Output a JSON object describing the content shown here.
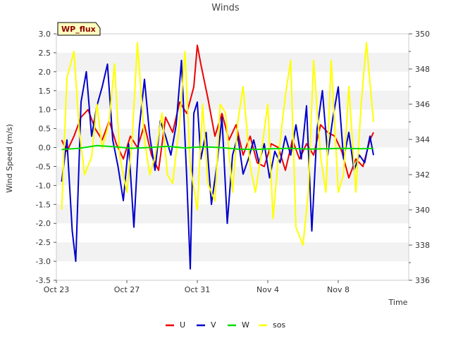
{
  "chart_data": {
    "type": "line",
    "title": "Winds",
    "site_label": "WP_flux",
    "xlabel": "Time",
    "ylabel": "Wind Speed (m/s)",
    "ylim": [
      -3.5,
      3.0
    ],
    "y2lim": [
      336,
      350
    ],
    "xlim_days": [
      23,
      43
    ],
    "x_ticks": [
      {
        "day": 23,
        "label": "Oct 23"
      },
      {
        "day": 27,
        "label": "Oct 27"
      },
      {
        "day": 31,
        "label": "Oct 31"
      },
      {
        "day": 35,
        "label": "Nov 4"
      },
      {
        "day": 39,
        "label": "Nov 8"
      }
    ],
    "y_ticks": [
      3.0,
      2.5,
      2.0,
      1.5,
      1.0,
      0.5,
      0.0,
      -0.5,
      -1.0,
      -1.5,
      -2.0,
      -2.5,
      -3.0,
      -3.5
    ],
    "y2_ticks": [
      350,
      348,
      346,
      344,
      342,
      340,
      338,
      336
    ],
    "grid": "horizontal bands",
    "legend_position": "bottom",
    "series": [
      {
        "name": "U",
        "color": "#ee0000",
        "axis": "left",
        "x": [
          23.3,
          23.6,
          24.0,
          24.4,
          24.8,
          25.2,
          25.6,
          26.0,
          26.4,
          26.8,
          27.2,
          27.6,
          28.0,
          28.4,
          28.8,
          29.2,
          29.6,
          30.0,
          30.4,
          30.8,
          31.0,
          31.2,
          31.6,
          32.0,
          32.4,
          32.8,
          33.2,
          33.6,
          34.0,
          34.4,
          34.8,
          35.2,
          35.6,
          36.0,
          36.4,
          36.8,
          37.2,
          37.6,
          38.0,
          38.4,
          38.8,
          39.2,
          39.6,
          40.0,
          40.4,
          40.8,
          41.0
        ],
        "values": [
          0.2,
          -0.1,
          0.3,
          0.8,
          1.0,
          0.5,
          0.2,
          0.7,
          0.1,
          -0.3,
          0.3,
          0.0,
          0.6,
          -0.2,
          -0.6,
          0.8,
          0.4,
          1.2,
          0.9,
          1.6,
          2.7,
          2.2,
          1.3,
          0.3,
          0.9,
          0.2,
          0.6,
          -0.2,
          0.3,
          -0.4,
          -0.5,
          0.1,
          0.0,
          -0.6,
          0.2,
          -0.3,
          0.1,
          -0.2,
          0.6,
          0.4,
          0.3,
          -0.1,
          -0.8,
          -0.3,
          -0.5,
          0.2,
          0.4
        ]
      },
      {
        "name": "V",
        "color": "#0000cc",
        "axis": "left",
        "x": [
          23.3,
          23.6,
          23.9,
          24.1,
          24.4,
          24.7,
          25.0,
          25.3,
          25.6,
          25.9,
          26.2,
          26.5,
          26.8,
          27.1,
          27.4,
          27.7,
          28.0,
          28.3,
          28.6,
          28.9,
          29.2,
          29.5,
          29.8,
          30.1,
          30.4,
          30.6,
          30.8,
          31.0,
          31.2,
          31.5,
          31.8,
          32.1,
          32.4,
          32.7,
          33.0,
          33.3,
          33.6,
          33.9,
          34.2,
          34.5,
          34.8,
          35.1,
          35.4,
          35.7,
          36.0,
          36.3,
          36.6,
          36.9,
          37.2,
          37.5,
          37.8,
          38.1,
          38.4,
          38.7,
          39.0,
          39.3,
          39.6,
          39.9,
          40.2,
          40.5,
          40.8,
          41.0
        ],
        "values": [
          -0.9,
          0.2,
          -2.2,
          -3.0,
          1.2,
          2.0,
          0.3,
          1.1,
          1.6,
          2.2,
          0.2,
          -0.5,
          -1.4,
          0.1,
          -2.1,
          0.5,
          1.8,
          0.3,
          -0.6,
          0.7,
          0.3,
          -0.2,
          0.6,
          2.3,
          -0.8,
          -3.2,
          0.9,
          1.2,
          -0.3,
          0.4,
          -1.5,
          -0.5,
          0.8,
          -2.0,
          -0.2,
          0.3,
          -0.7,
          -0.3,
          0.2,
          -0.4,
          0.1,
          -0.8,
          -0.1,
          -0.4,
          0.3,
          -0.2,
          0.6,
          -0.3,
          1.1,
          -2.2,
          0.5,
          1.5,
          -0.2,
          0.8,
          1.6,
          -0.3,
          0.4,
          -0.6,
          -0.2,
          -0.4,
          0.3,
          -0.2
        ]
      },
      {
        "name": "W",
        "color": "#00dd00",
        "axis": "left",
        "x": [
          23.3,
          24.3,
          25.3,
          26.3,
          27.3,
          28.3,
          29.3,
          30.3,
          31.3,
          32.3,
          33.3,
          34.3,
          35.3,
          36.3,
          37.3,
          38.3,
          39.3,
          40.3,
          41.0
        ],
        "values": [
          -0.05,
          -0.02,
          0.05,
          0.02,
          -0.02,
          0.0,
          0.03,
          -0.01,
          0.02,
          0.0,
          -0.04,
          -0.05,
          -0.03,
          -0.02,
          -0.04,
          -0.03,
          -0.02,
          -0.03,
          -0.02
        ]
      },
      {
        "name": "sos",
        "color": "#ffff00",
        "axis": "right",
        "x": [
          23.3,
          23.6,
          24.0,
          24.3,
          24.6,
          25.0,
          25.3,
          25.6,
          26.0,
          26.3,
          26.6,
          27.0,
          27.3,
          27.6,
          28.0,
          28.3,
          28.6,
          29.0,
          29.3,
          29.6,
          30.0,
          30.3,
          30.6,
          31.0,
          31.3,
          31.6,
          32.0,
          32.3,
          32.6,
          33.0,
          33.3,
          33.6,
          34.0,
          34.3,
          34.6,
          35.0,
          35.3,
          35.6,
          36.0,
          36.3,
          36.6,
          37.0,
          37.3,
          37.6,
          38.0,
          38.3,
          38.6,
          39.0,
          39.3,
          39.6,
          40.0,
          40.3,
          40.6,
          41.0
        ],
        "values": [
          340.0,
          347.5,
          349.0,
          344.5,
          342.0,
          343.0,
          346.0,
          343.5,
          345.0,
          348.3,
          343.0,
          341.0,
          344.0,
          349.5,
          344.0,
          342.0,
          343.0,
          345.5,
          342.0,
          341.5,
          345.0,
          349.0,
          342.5,
          340.0,
          346.0,
          341.5,
          340.5,
          346.0,
          345.5,
          341.0,
          345.0,
          347.0,
          342.5,
          341.0,
          343.0,
          346.0,
          339.5,
          343.0,
          346.5,
          348.5,
          339.0,
          338.0,
          341.0,
          348.5,
          343.0,
          341.0,
          348.5,
          341.0,
          342.0,
          347.0,
          341.0,
          346.0,
          349.5,
          345.0
        ]
      }
    ]
  }
}
